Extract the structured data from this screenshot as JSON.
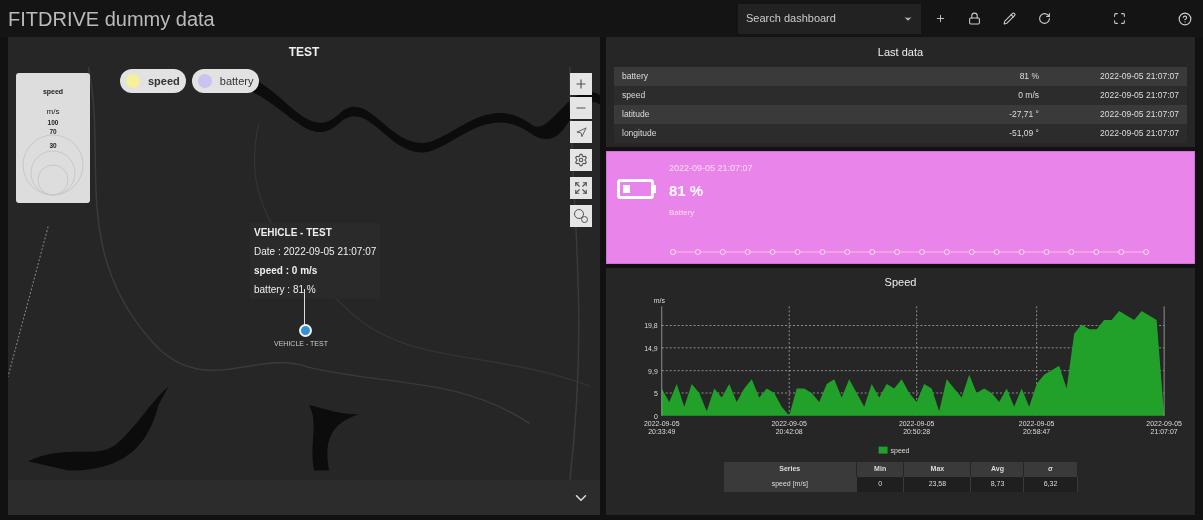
{
  "header": {
    "title": "FITDRIVE dummy data",
    "search": {
      "placeholder": "Search dashboard"
    }
  },
  "map_panel": {
    "title": "TEST",
    "gauge": {
      "title": "speed",
      "unit": "m/s",
      "rings": [
        "100",
        "70",
        "30"
      ]
    },
    "legend": [
      {
        "label": "speed",
        "color": "#f4f19a"
      },
      {
        "label": "battery",
        "color": "#c9c3ef"
      }
    ],
    "tooltip": {
      "title": "VEHICLE - TEST",
      "lines": [
        "Date : 2022-09-05 21:07:07",
        "speed : 0 m/s",
        "battery : 81 %"
      ]
    },
    "marker_label": "VEHICLE - TEST"
  },
  "last_data": {
    "title": "Last data",
    "rows": [
      {
        "name": "battery",
        "value": "81 %",
        "time": "2022-09-05 21:07:07"
      },
      {
        "name": "speed",
        "value": "0 m/s",
        "time": "2022-09-05 21:07:07"
      },
      {
        "name": "latitude",
        "value": "-27,71 °",
        "time": "2022-09-05 21:07:07"
      },
      {
        "name": "longitude",
        "value": "-51,09 °",
        "time": "2022-09-05 21:07:07"
      }
    ]
  },
  "battery_card": {
    "time": "2022-09-05 21:07:07",
    "value": "81 %",
    "label": "Battery"
  },
  "speed_panel": {
    "chart_data": {
      "type": "area",
      "title": "Speed",
      "ylabel": "m/s",
      "grid": true,
      "categories": [
        "2022-09-05 20:33:49",
        null,
        null,
        null,
        null,
        null,
        null,
        null,
        null,
        null,
        null,
        null,
        null,
        null,
        null,
        null,
        null,
        "2022-09-05 20:42:08",
        null,
        null,
        null,
        null,
        null,
        null,
        null,
        null,
        null,
        null,
        null,
        null,
        null,
        null,
        null,
        null,
        "2022-09-05 20:50:28",
        null,
        null,
        null,
        null,
        null,
        null,
        null,
        null,
        null,
        null,
        null,
        null,
        null,
        null,
        null,
        "2022-09-05 20:58:47",
        null,
        null,
        null,
        null,
        null,
        null,
        null,
        null,
        null,
        null,
        null,
        null,
        null,
        null,
        null,
        null,
        "2022-09-05 21:07:07"
      ],
      "series": [
        {
          "name": "speed",
          "color": "#22a12a",
          "values": [
            6,
            3,
            7,
            2,
            7,
            5,
            1,
            6,
            4,
            7,
            3,
            6,
            8,
            4,
            6,
            5,
            2,
            0,
            6,
            6,
            5,
            3,
            7,
            8,
            4,
            8,
            5,
            2,
            7,
            4,
            7,
            6,
            8,
            5,
            3,
            7,
            6,
            1,
            8,
            6,
            4,
            9,
            5,
            6,
            5,
            3,
            6,
            2,
            6,
            2,
            7,
            9,
            10,
            11,
            6,
            18,
            20,
            19,
            19,
            21,
            21,
            23,
            22,
            21,
            23,
            22,
            21,
            0
          ]
        }
      ],
      "ylim": [
        0,
        24
      ],
      "yticks": [
        0,
        5,
        {
          "value": 9.9,
          "label": "9,9"
        },
        {
          "value": 14.9,
          "label": "14,9"
        },
        {
          "value": 19.8,
          "label": "19,8"
        }
      ]
    },
    "stats": {
      "columns": [
        "Series",
        "Min",
        "Max",
        "Avg",
        "σ"
      ],
      "rows": [
        [
          "speed [m/s]",
          "0",
          "23,58",
          "8,73",
          "6,32"
        ]
      ]
    }
  }
}
